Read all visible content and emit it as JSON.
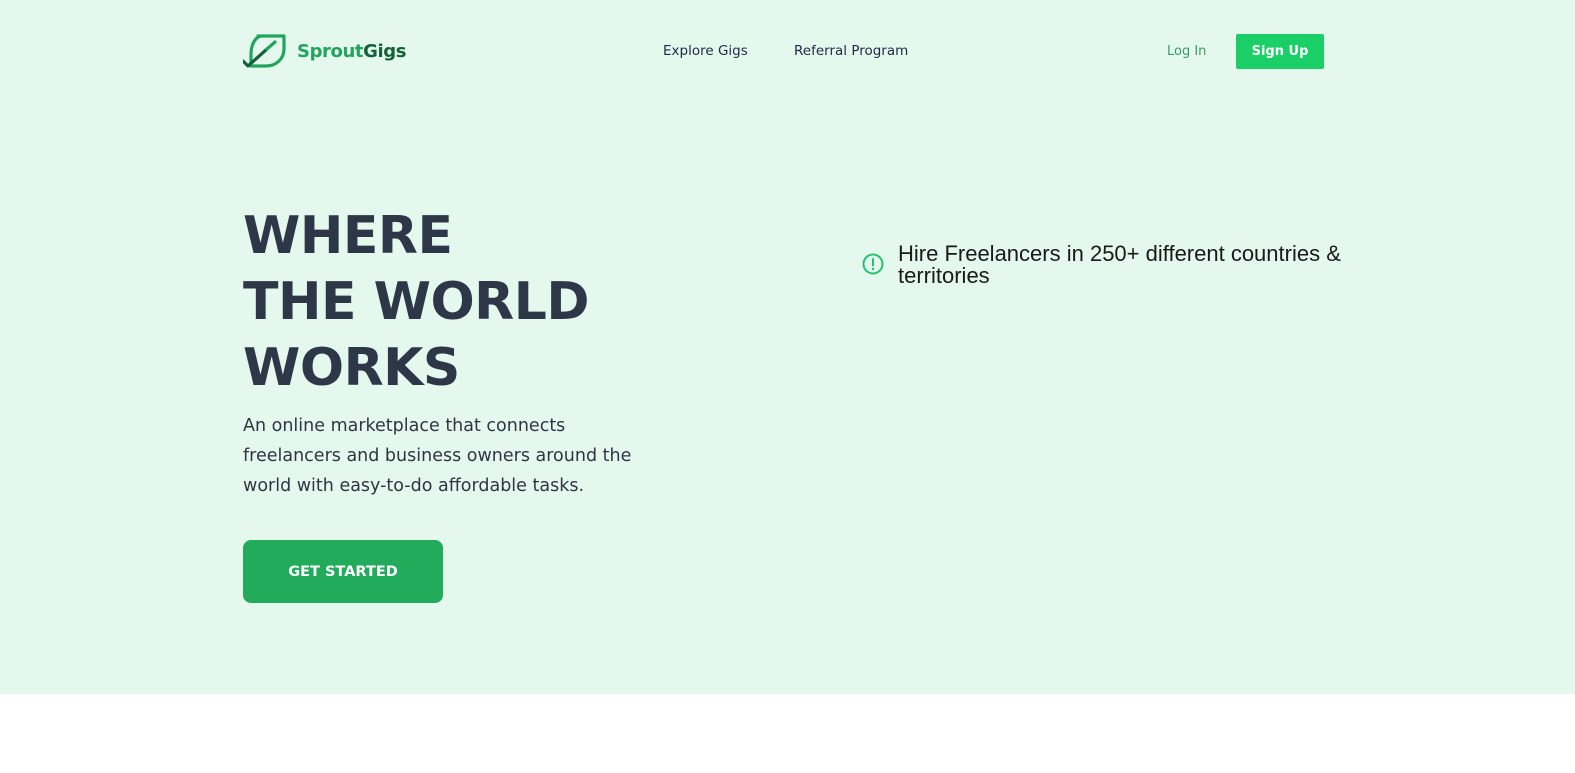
{
  "header": {
    "logo": {
      "part1": "Sprout",
      "part2": "Gigs",
      "icon": "leaf-icon"
    },
    "nav": [
      {
        "label": "Explore Gigs"
      },
      {
        "label": "Referral Program"
      }
    ],
    "login_label": "Log In",
    "signup_label": "Sign Up"
  },
  "hero": {
    "headline": [
      "WHERE",
      "THE WORLD",
      "WORKS"
    ],
    "subtext": "An online marketplace that connects freelancers and business owners around the world with easy-to-do affordable tasks.",
    "cta_label": "GET STARTED",
    "feature": {
      "icon": "alert-circle-icon",
      "text": "Hire Freelancers in 250+ different countries & territories"
    }
  },
  "colors": {
    "hero_bg": "#e4f8ee",
    "brand_green": "#22a45d",
    "brand_dark_green": "#14613a",
    "signup_bg": "#19cf66",
    "cta_bg": "#22ab5b",
    "headline": "#2d3748"
  }
}
